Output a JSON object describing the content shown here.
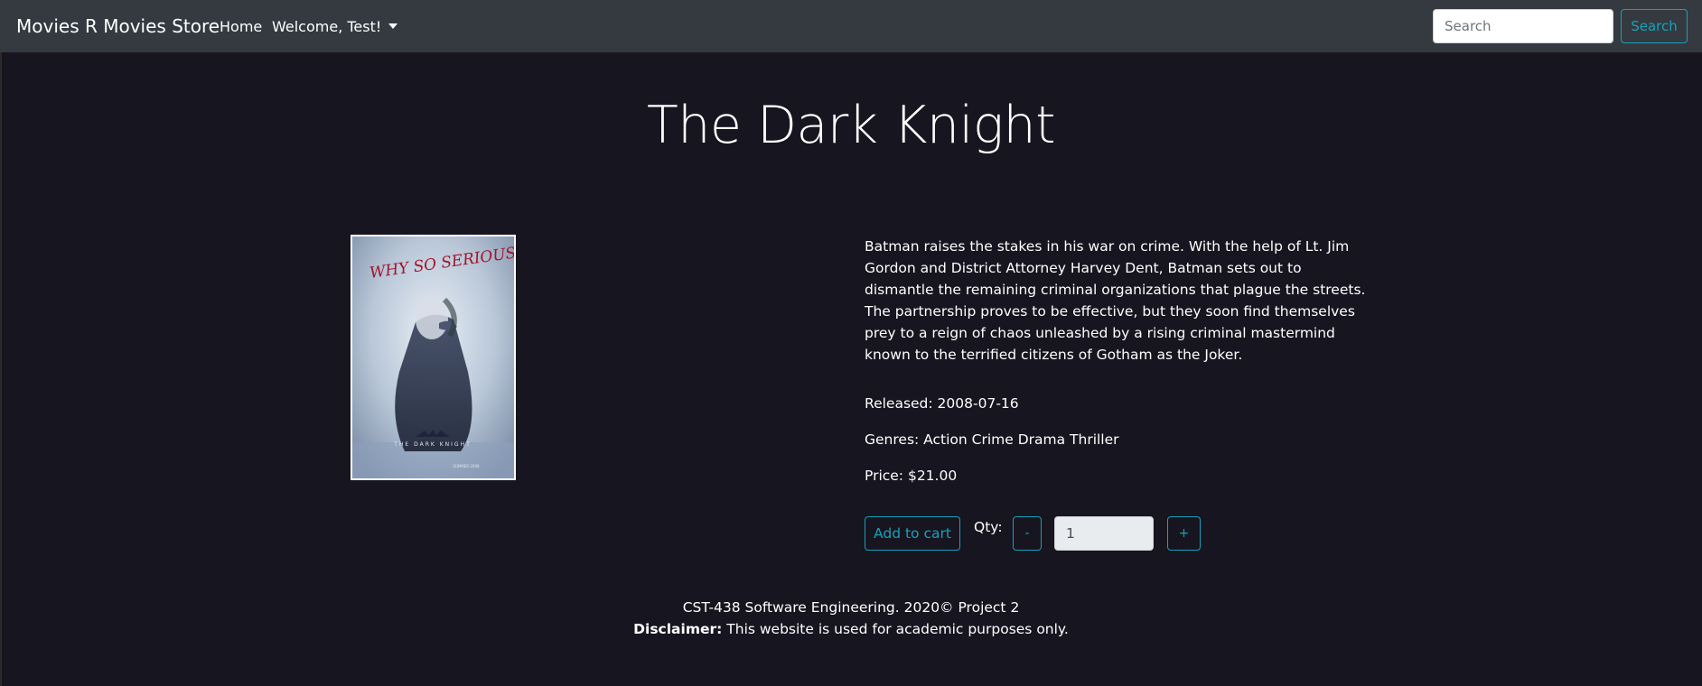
{
  "navbar": {
    "brand": "Movies R Movies Store",
    "home_label": "Home",
    "welcome_label": "Welcome, Test!",
    "search_placeholder": "Search",
    "search_button": "Search"
  },
  "movie": {
    "title": "The Dark Knight",
    "poster": {
      "tagline": "WHY SO SERIOUS?",
      "wordmark": "THE DARK KNIGHT",
      "date_text": "SUMMER 2008"
    },
    "description": "Batman raises the stakes in his war on crime. With the help of Lt. Jim Gordon and District Attorney Harvey Dent, Batman sets out to dismantle the remaining criminal organizations that plague the streets. The partnership proves to be effective, but they soon find themselves prey to a reign of chaos unleashed by a rising criminal mastermind known to the terrified citizens of Gotham as the Joker.",
    "released": "Released: 2008-07-16",
    "genres": "Genres: Action Crime Drama Thriller",
    "price": "Price: $21.00"
  },
  "cart": {
    "add_button": "Add to cart",
    "qty_label": "Qty:",
    "minus_label": "-",
    "plus_label": "+",
    "qty_value": "1"
  },
  "footer": {
    "line1": "CST-438 Software Engineering. 2020© Project 2",
    "disclaimer_label": "Disclaimer:",
    "disclaimer_text": " This website is used for academic purposes only."
  },
  "colors": {
    "background": "#171520",
    "navbar": "#343a40",
    "accent": "#17a2b8"
  }
}
